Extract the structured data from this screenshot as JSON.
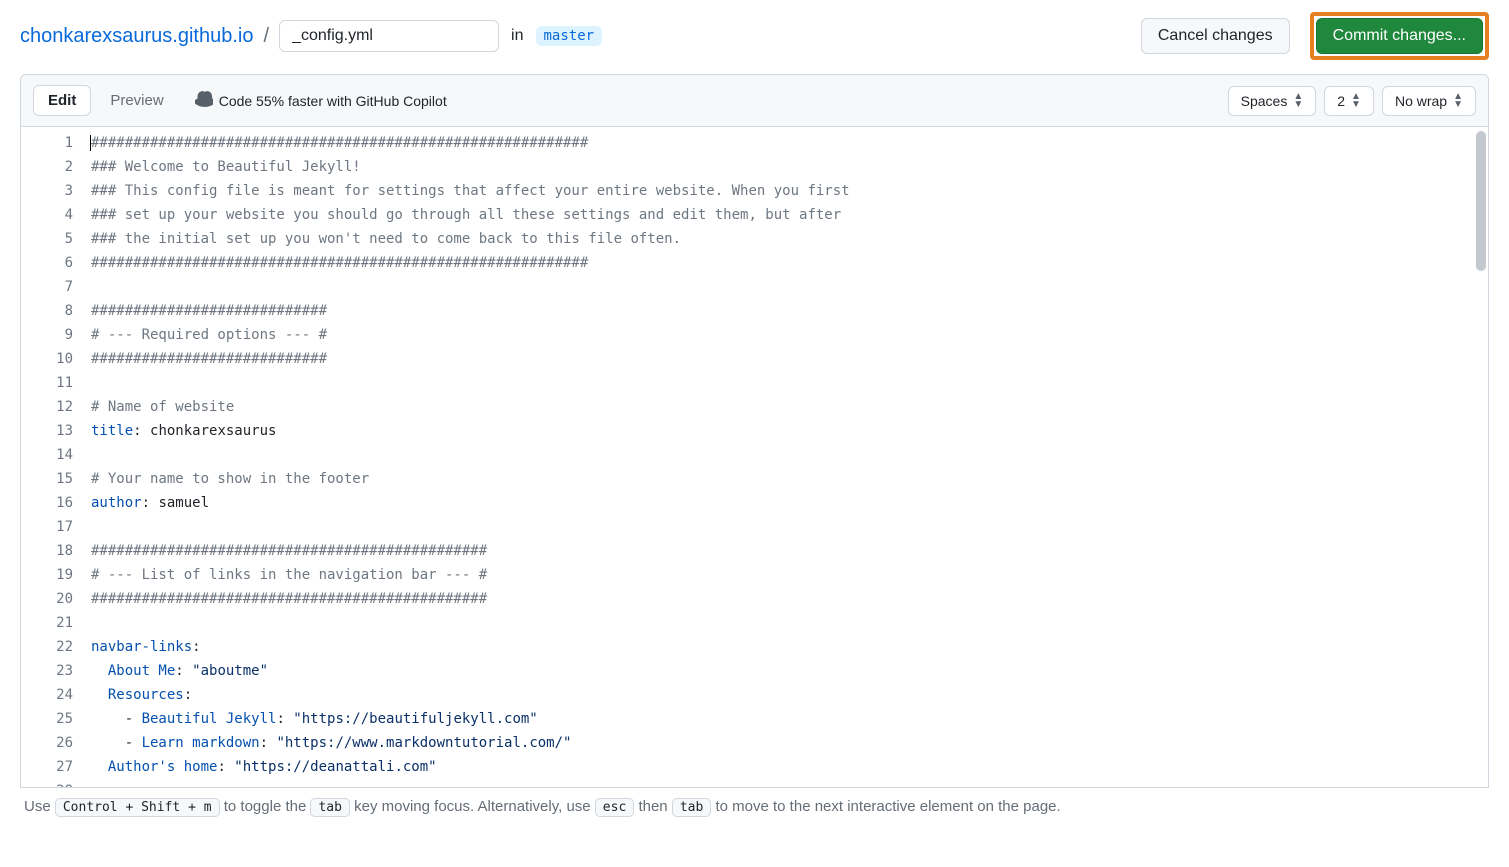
{
  "header": {
    "repo": "chonkarexsaurus.github.io",
    "filename": "_config.yml",
    "in_label": "in",
    "branch": "master",
    "cancel": "Cancel changes",
    "commit": "Commit changes..."
  },
  "toolbar": {
    "edit_tab": "Edit",
    "preview_tab": "Preview",
    "copilot_text": "Code 55% faster with GitHub Copilot",
    "indent_mode": "Spaces",
    "indent_size": "2",
    "wrap_mode": "No wrap"
  },
  "code": {
    "lines": [
      [
        [
          "comment",
          "###########################################################"
        ]
      ],
      [
        [
          "comment",
          "### Welcome to Beautiful Jekyll!"
        ]
      ],
      [
        [
          "comment",
          "### This config file is meant for settings that affect your entire website. When you first"
        ]
      ],
      [
        [
          "comment",
          "### set up your website you should go through all these settings and edit them, but after"
        ]
      ],
      [
        [
          "comment",
          "### the initial set up you won't need to come back to this file often."
        ]
      ],
      [
        [
          "comment",
          "###########################################################"
        ]
      ],
      [],
      [
        [
          "comment",
          "############################"
        ]
      ],
      [
        [
          "comment",
          "# --- Required options --- #"
        ]
      ],
      [
        [
          "comment",
          "############################"
        ]
      ],
      [],
      [
        [
          "comment",
          "# Name of website"
        ]
      ],
      [
        [
          "key",
          "title"
        ],
        [
          "punc",
          ": "
        ],
        [
          "plain",
          "chonkarexsaurus"
        ]
      ],
      [],
      [
        [
          "comment",
          "# Your name to show in the footer"
        ]
      ],
      [
        [
          "key",
          "author"
        ],
        [
          "punc",
          ": "
        ],
        [
          "plain",
          "samuel"
        ]
      ],
      [],
      [
        [
          "comment",
          "###############################################"
        ]
      ],
      [
        [
          "comment",
          "# --- List of links in the navigation bar --- #"
        ]
      ],
      [
        [
          "comment",
          "###############################################"
        ]
      ],
      [],
      [
        [
          "key",
          "navbar-links"
        ],
        [
          "punc",
          ":"
        ]
      ],
      [
        [
          "plain",
          "  "
        ],
        [
          "key",
          "About Me"
        ],
        [
          "punc",
          ": "
        ],
        [
          "str",
          "\"aboutme\""
        ]
      ],
      [
        [
          "plain",
          "  "
        ],
        [
          "key",
          "Resources"
        ],
        [
          "punc",
          ":"
        ]
      ],
      [
        [
          "plain",
          "    "
        ],
        [
          "punc",
          "- "
        ],
        [
          "key",
          "Beautiful Jekyll"
        ],
        [
          "punc",
          ": "
        ],
        [
          "str",
          "\"https://beautifuljekyll.com\""
        ]
      ],
      [
        [
          "plain",
          "    "
        ],
        [
          "punc",
          "- "
        ],
        [
          "key",
          "Learn markdown"
        ],
        [
          "punc",
          ": "
        ],
        [
          "str",
          "\"https://www.markdowntutorial.com/\""
        ]
      ],
      [
        [
          "plain",
          "  "
        ],
        [
          "key",
          "Author's home"
        ],
        [
          "punc",
          ": "
        ],
        [
          "str",
          "\"https://deanattali.com\""
        ]
      ],
      []
    ]
  },
  "footer": {
    "prefix": "Use ",
    "kbd1": "Control + Shift + m",
    "mid1": " to toggle the ",
    "kbd2": "tab",
    "mid2": " key moving focus. Alternatively, use ",
    "kbd3": "esc",
    "mid3": " then ",
    "kbd4": "tab",
    "suffix": " to move to the next interactive element on the page."
  }
}
